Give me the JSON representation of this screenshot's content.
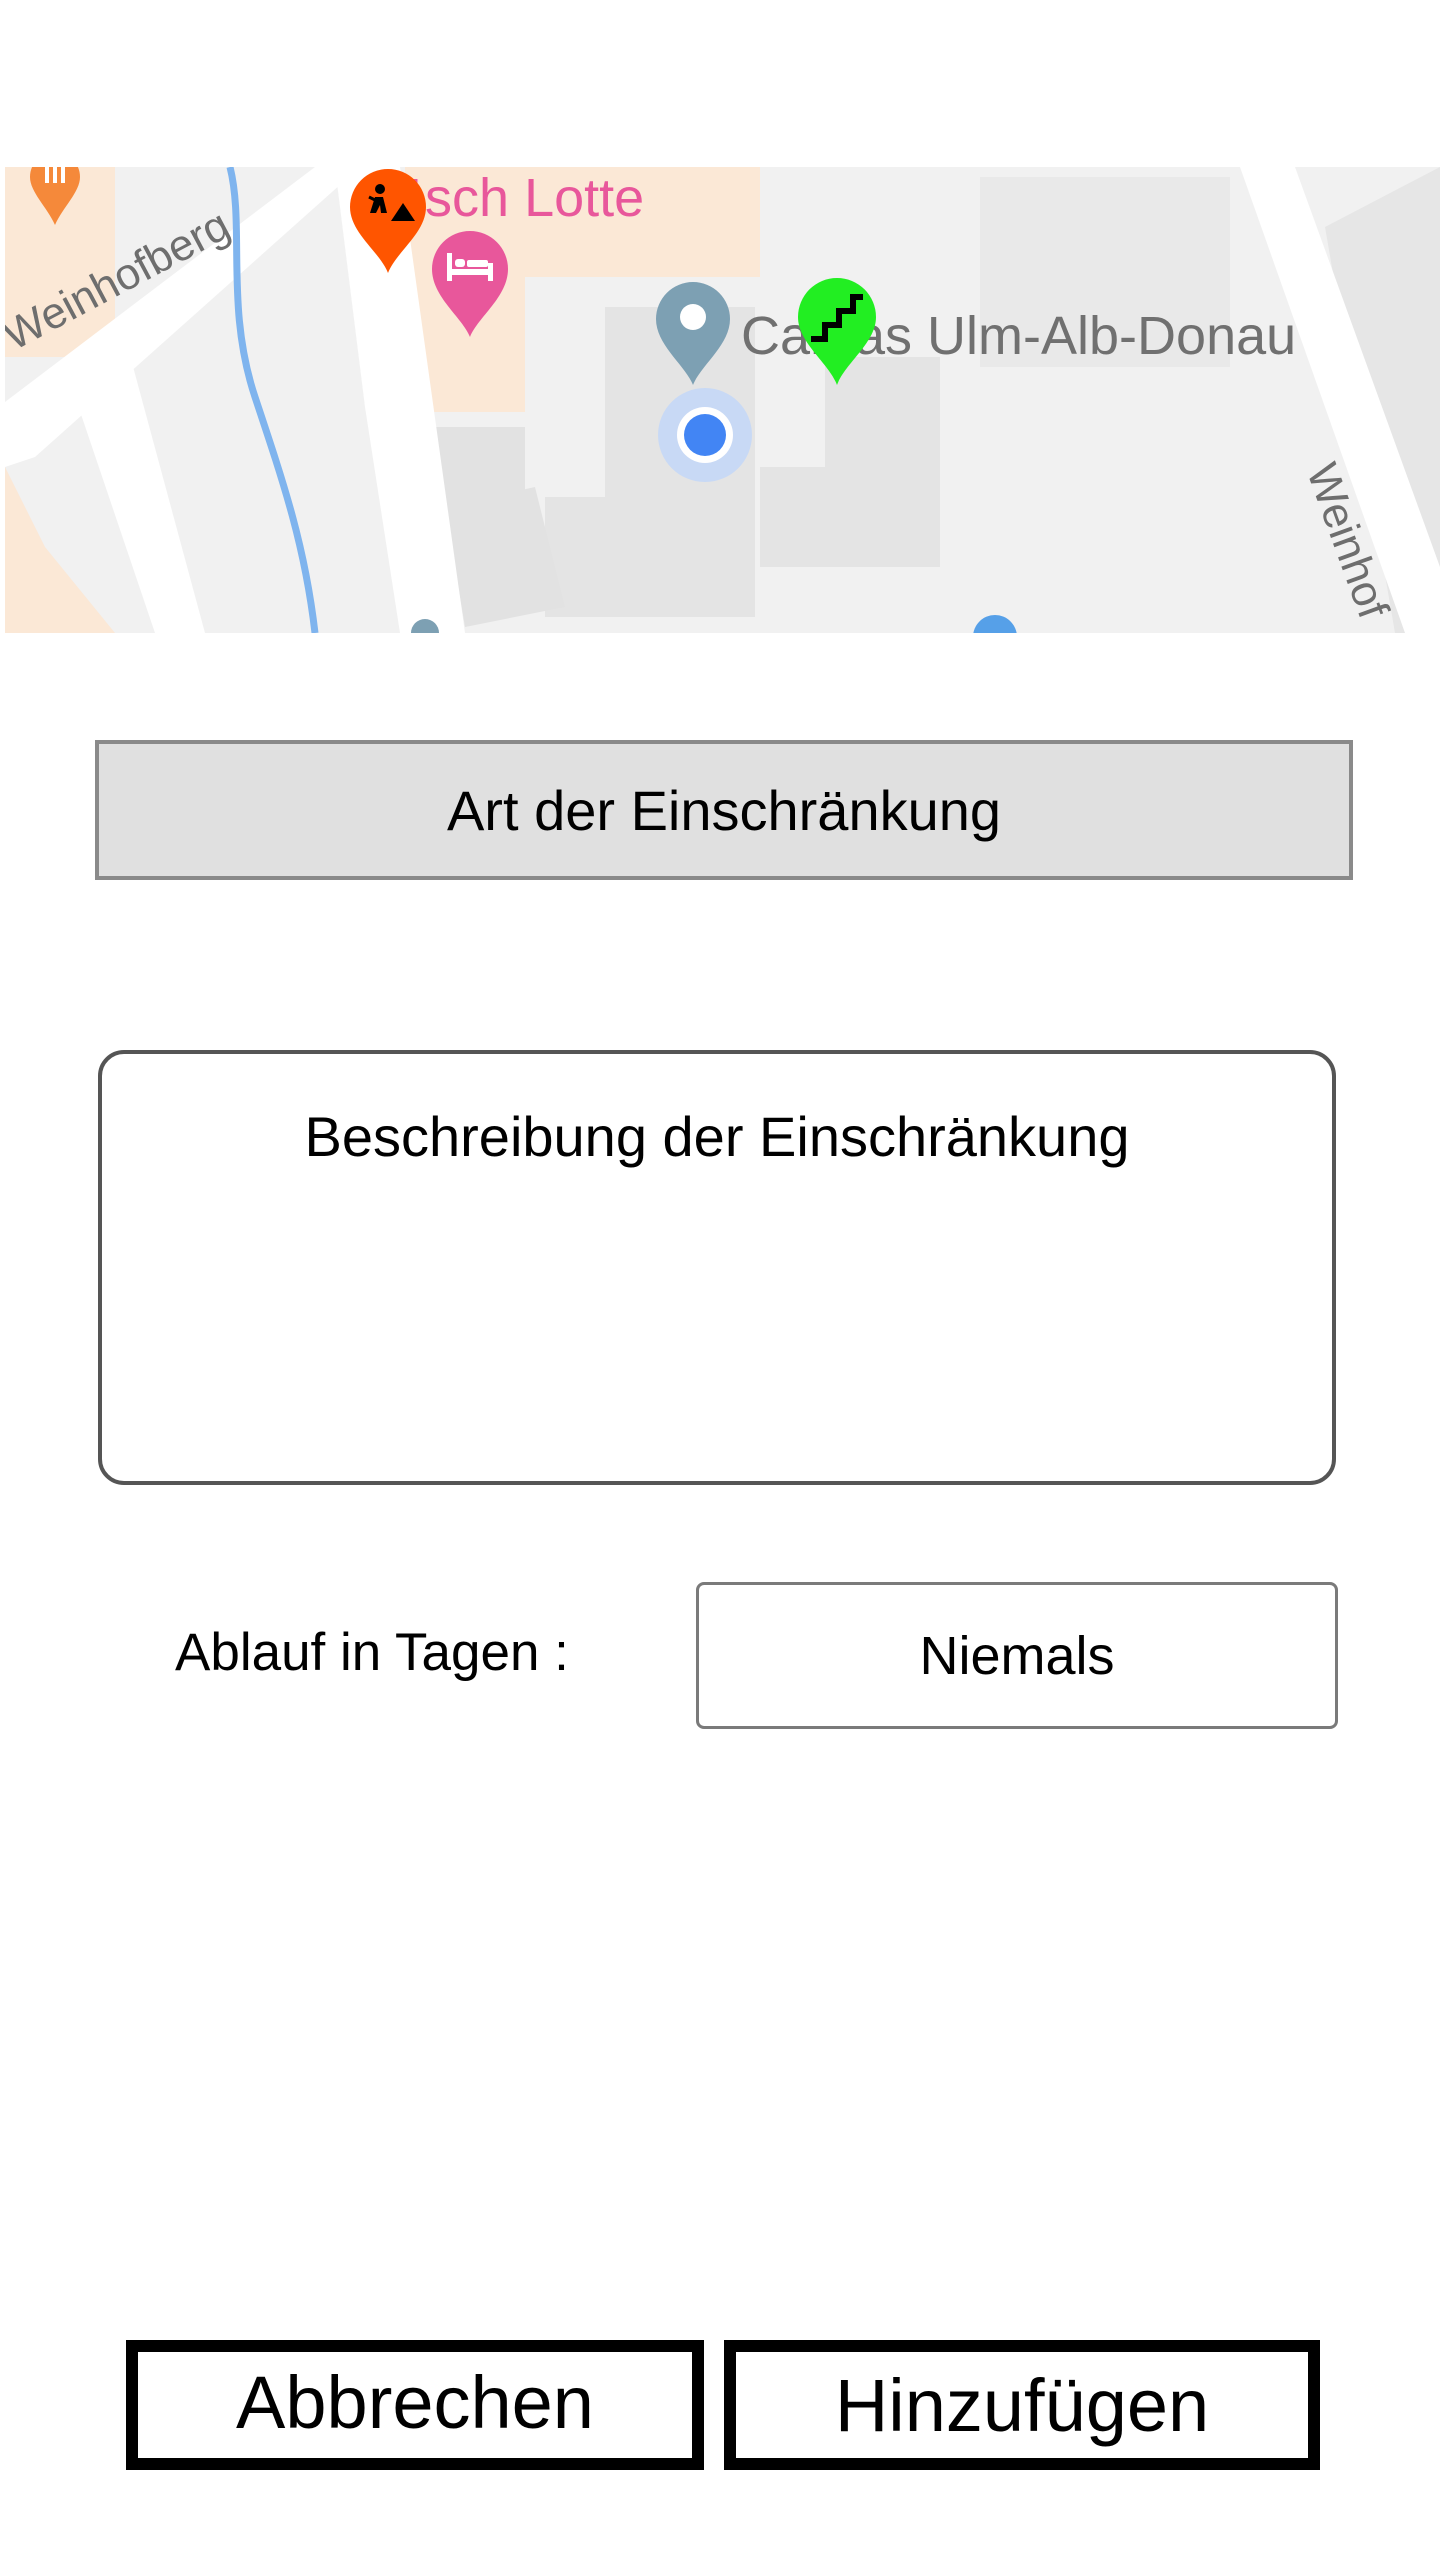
{
  "map": {
    "poi_name_label": "ösch Lotte",
    "place_label": "Caritas Ulm-Alb-Donau",
    "street_label_left": "Weinhofberg",
    "street_label_right": "Weinhof",
    "markers": [
      {
        "name": "construction-marker",
        "icon": "construction-worker-icon",
        "color": "#ff5500"
      },
      {
        "name": "hotel-marker",
        "icon": "bed-icon",
        "color": "#e8579b"
      },
      {
        "name": "place-marker",
        "icon": "map-pin-icon",
        "color": "#7da0b3"
      },
      {
        "name": "stairs-marker",
        "icon": "stairs-icon",
        "color": "#22ee22"
      },
      {
        "name": "current-location",
        "icon": "location-dot-icon",
        "color": "#4285f4"
      },
      {
        "name": "restaurant-marker",
        "icon": "fork-knife-icon",
        "color": "#f5893a"
      }
    ]
  },
  "form": {
    "restriction_type": "Art der Einschränkung",
    "description_placeholder": "Beschreibung der Einschränkung",
    "expiry_label": "Ablauf in Tagen :",
    "expiry_value": "Niemals"
  },
  "actions": {
    "cancel_label": "Abbrechen",
    "add_label": "Hinzufügen"
  }
}
